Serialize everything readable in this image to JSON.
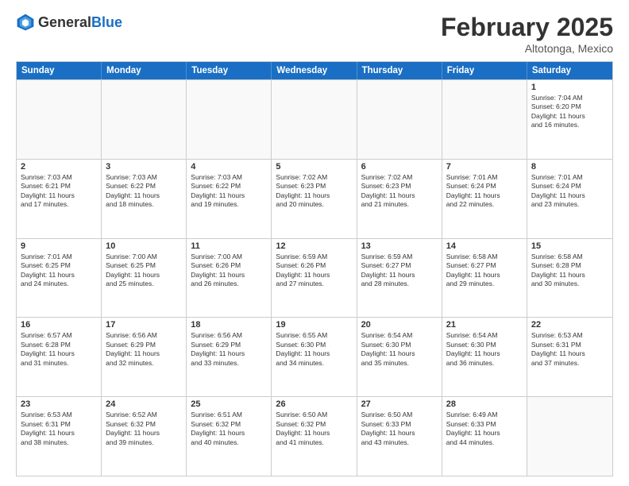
{
  "header": {
    "logo_general": "General",
    "logo_blue": "Blue",
    "month_title": "February 2025",
    "location": "Altotonga, Mexico"
  },
  "days_of_week": [
    "Sunday",
    "Monday",
    "Tuesday",
    "Wednesday",
    "Thursday",
    "Friday",
    "Saturday"
  ],
  "weeks": [
    [
      {
        "day": "",
        "info": ""
      },
      {
        "day": "",
        "info": ""
      },
      {
        "day": "",
        "info": ""
      },
      {
        "day": "",
        "info": ""
      },
      {
        "day": "",
        "info": ""
      },
      {
        "day": "",
        "info": ""
      },
      {
        "day": "1",
        "info": "Sunrise: 7:04 AM\nSunset: 6:20 PM\nDaylight: 11 hours\nand 16 minutes."
      }
    ],
    [
      {
        "day": "2",
        "info": "Sunrise: 7:03 AM\nSunset: 6:21 PM\nDaylight: 11 hours\nand 17 minutes."
      },
      {
        "day": "3",
        "info": "Sunrise: 7:03 AM\nSunset: 6:22 PM\nDaylight: 11 hours\nand 18 minutes."
      },
      {
        "day": "4",
        "info": "Sunrise: 7:03 AM\nSunset: 6:22 PM\nDaylight: 11 hours\nand 19 minutes."
      },
      {
        "day": "5",
        "info": "Sunrise: 7:02 AM\nSunset: 6:23 PM\nDaylight: 11 hours\nand 20 minutes."
      },
      {
        "day": "6",
        "info": "Sunrise: 7:02 AM\nSunset: 6:23 PM\nDaylight: 11 hours\nand 21 minutes."
      },
      {
        "day": "7",
        "info": "Sunrise: 7:01 AM\nSunset: 6:24 PM\nDaylight: 11 hours\nand 22 minutes."
      },
      {
        "day": "8",
        "info": "Sunrise: 7:01 AM\nSunset: 6:24 PM\nDaylight: 11 hours\nand 23 minutes."
      }
    ],
    [
      {
        "day": "9",
        "info": "Sunrise: 7:01 AM\nSunset: 6:25 PM\nDaylight: 11 hours\nand 24 minutes."
      },
      {
        "day": "10",
        "info": "Sunrise: 7:00 AM\nSunset: 6:25 PM\nDaylight: 11 hours\nand 25 minutes."
      },
      {
        "day": "11",
        "info": "Sunrise: 7:00 AM\nSunset: 6:26 PM\nDaylight: 11 hours\nand 26 minutes."
      },
      {
        "day": "12",
        "info": "Sunrise: 6:59 AM\nSunset: 6:26 PM\nDaylight: 11 hours\nand 27 minutes."
      },
      {
        "day": "13",
        "info": "Sunrise: 6:59 AM\nSunset: 6:27 PM\nDaylight: 11 hours\nand 28 minutes."
      },
      {
        "day": "14",
        "info": "Sunrise: 6:58 AM\nSunset: 6:27 PM\nDaylight: 11 hours\nand 29 minutes."
      },
      {
        "day": "15",
        "info": "Sunrise: 6:58 AM\nSunset: 6:28 PM\nDaylight: 11 hours\nand 30 minutes."
      }
    ],
    [
      {
        "day": "16",
        "info": "Sunrise: 6:57 AM\nSunset: 6:28 PM\nDaylight: 11 hours\nand 31 minutes."
      },
      {
        "day": "17",
        "info": "Sunrise: 6:56 AM\nSunset: 6:29 PM\nDaylight: 11 hours\nand 32 minutes."
      },
      {
        "day": "18",
        "info": "Sunrise: 6:56 AM\nSunset: 6:29 PM\nDaylight: 11 hours\nand 33 minutes."
      },
      {
        "day": "19",
        "info": "Sunrise: 6:55 AM\nSunset: 6:30 PM\nDaylight: 11 hours\nand 34 minutes."
      },
      {
        "day": "20",
        "info": "Sunrise: 6:54 AM\nSunset: 6:30 PM\nDaylight: 11 hours\nand 35 minutes."
      },
      {
        "day": "21",
        "info": "Sunrise: 6:54 AM\nSunset: 6:30 PM\nDaylight: 11 hours\nand 36 minutes."
      },
      {
        "day": "22",
        "info": "Sunrise: 6:53 AM\nSunset: 6:31 PM\nDaylight: 11 hours\nand 37 minutes."
      }
    ],
    [
      {
        "day": "23",
        "info": "Sunrise: 6:53 AM\nSunset: 6:31 PM\nDaylight: 11 hours\nand 38 minutes."
      },
      {
        "day": "24",
        "info": "Sunrise: 6:52 AM\nSunset: 6:32 PM\nDaylight: 11 hours\nand 39 minutes."
      },
      {
        "day": "25",
        "info": "Sunrise: 6:51 AM\nSunset: 6:32 PM\nDaylight: 11 hours\nand 40 minutes."
      },
      {
        "day": "26",
        "info": "Sunrise: 6:50 AM\nSunset: 6:32 PM\nDaylight: 11 hours\nand 41 minutes."
      },
      {
        "day": "27",
        "info": "Sunrise: 6:50 AM\nSunset: 6:33 PM\nDaylight: 11 hours\nand 43 minutes."
      },
      {
        "day": "28",
        "info": "Sunrise: 6:49 AM\nSunset: 6:33 PM\nDaylight: 11 hours\nand 44 minutes."
      },
      {
        "day": "",
        "info": ""
      }
    ]
  ]
}
